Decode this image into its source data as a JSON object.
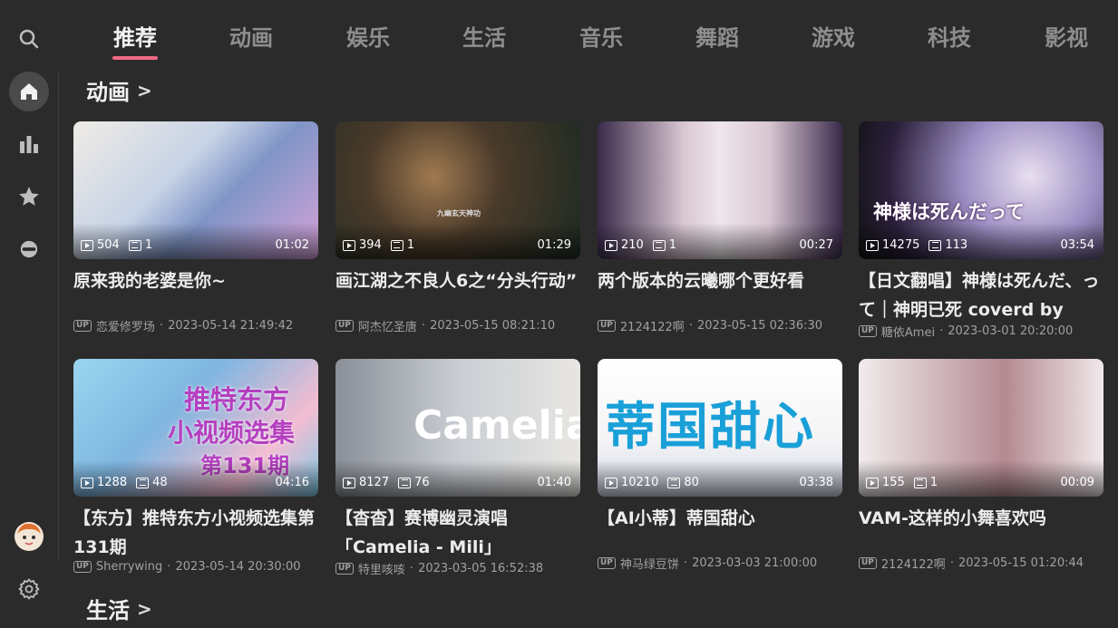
{
  "tabs": [
    "推荐",
    "动画",
    "娱乐",
    "生活",
    "音乐",
    "舞蹈",
    "游戏",
    "科技",
    "影视"
  ],
  "sections": {
    "anime_title": "动画",
    "life_title": "生活",
    "chevron": ">"
  },
  "thumb_text": {
    "c2": "九幽玄天神功",
    "c4": "神様は死んだって",
    "c5_l1": "推特东方",
    "c5_l2": "小视频选集",
    "c5_l3": "第131期",
    "c6": "Camelia",
    "c7": "蒂国甜心"
  },
  "cards": [
    {
      "views": "504",
      "danmaku": "1",
      "duration": "01:02",
      "title": "原来我的老婆是你~",
      "up": "恋爱修罗场",
      "date": "2023-05-14 21:49:42"
    },
    {
      "views": "394",
      "danmaku": "1",
      "duration": "01:29",
      "title": "画江湖之不良人6之“分头行动”",
      "up": "阿杰忆圣唐",
      "date": "2023-05-15 08:21:10"
    },
    {
      "views": "210",
      "danmaku": "1",
      "duration": "00:27",
      "title": "两个版本的云曦哪个更好看",
      "up": "2124122啊",
      "date": "2023-05-15 02:36:30"
    },
    {
      "views": "14275",
      "danmaku": "113",
      "duration": "03:54",
      "title": "【日文翻唱】神様は死んだ、って｜神明已死 coverd by",
      "up": "糖依Amei",
      "date": "2023-03-01 20:20:00"
    },
    {
      "views": "1288",
      "danmaku": "48",
      "duration": "04:16",
      "title": "【东方】推特东方小视频选集第131期",
      "up": "Sherrywing",
      "date": "2023-05-14 20:30:00"
    },
    {
      "views": "8127",
      "danmaku": "76",
      "duration": "01:40",
      "title": "【杳杳】赛博幽灵演唱「Camelia - Mili」",
      "up": "特里咳咳",
      "date": "2023-03-05 16:52:38"
    },
    {
      "views": "10210",
      "danmaku": "80",
      "duration": "03:38",
      "title": "【AI小蒂】蒂国甜心",
      "up": "神马绿豆饼",
      "date": "2023-03-03 21:00:00"
    },
    {
      "views": "155",
      "danmaku": "1",
      "duration": "00:09",
      "title": "VAM-这样的小舞喜欢吗",
      "up": "2124122啊",
      "date": "2023-05-15 01:20:44"
    }
  ],
  "meta_sep": "·",
  "up_badge": "UP",
  "colors": {
    "accent": "#f06a84",
    "background": "#2b2b2b"
  },
  "icons": [
    "search-icon",
    "home-icon",
    "bar-chart-icon",
    "star-icon",
    "helmet-icon",
    "avatar",
    "gear-icon"
  ]
}
